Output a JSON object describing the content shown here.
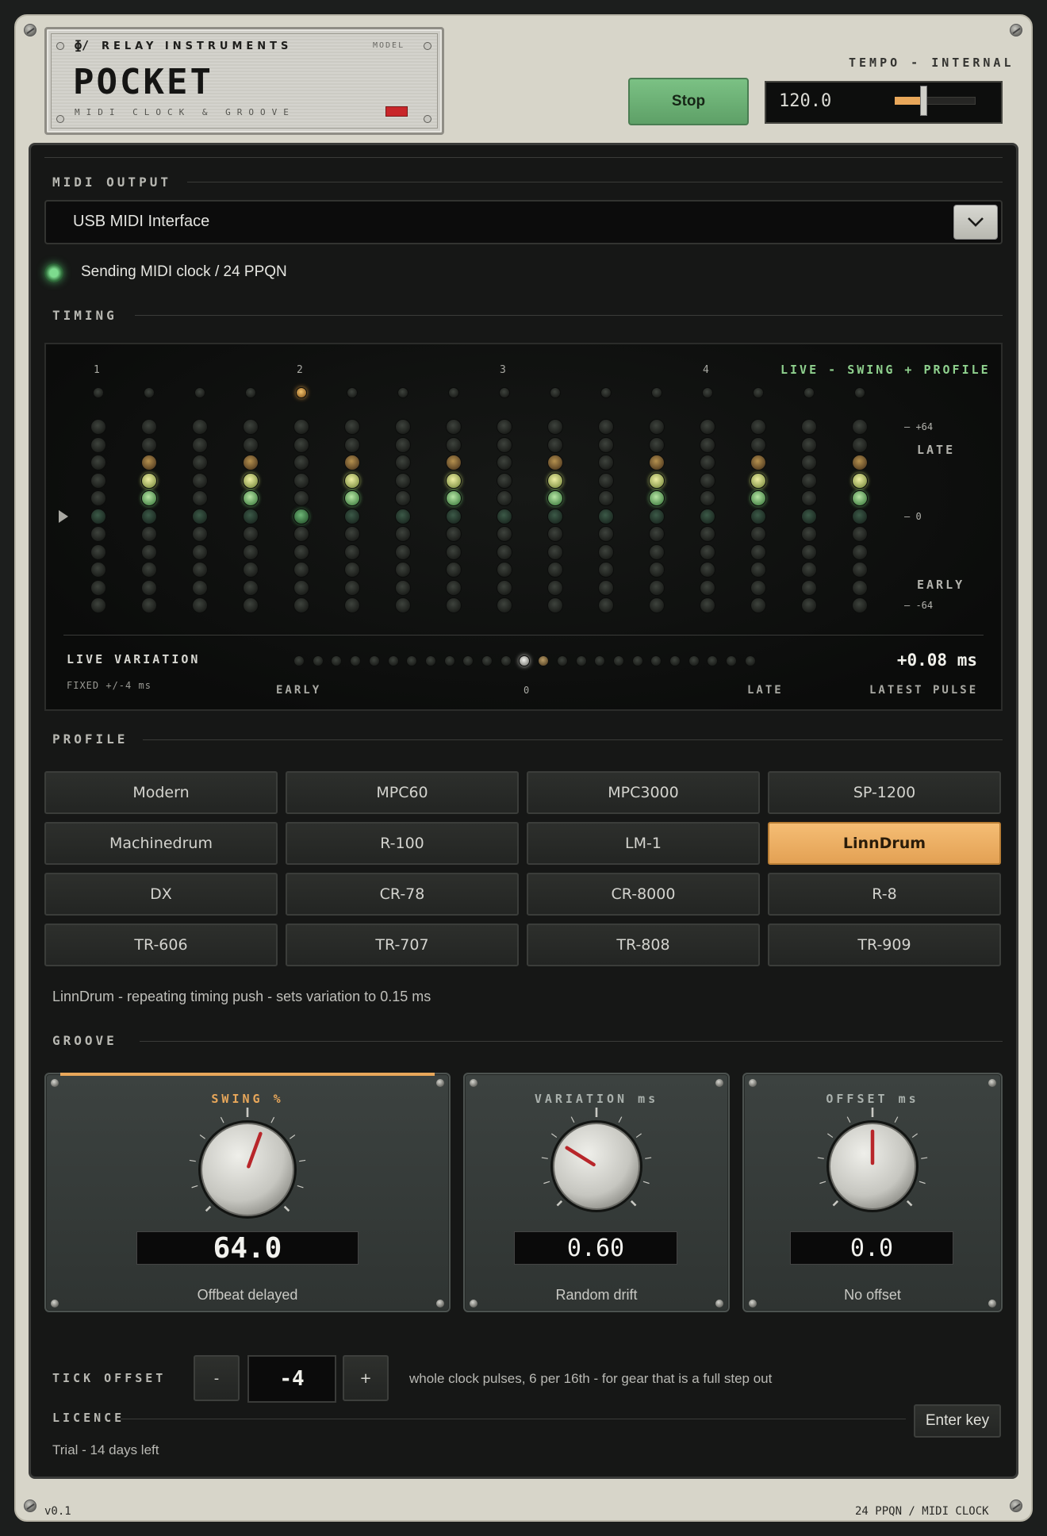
{
  "header": {
    "brand_logo": "ɸ/",
    "brand": "RELAY INSTRUMENTS",
    "model_tag": "MODEL",
    "product_name": "POCKET",
    "product_subtitle": "MIDI CLOCK & GROOVE",
    "stop_label": "Stop",
    "tempo_label": "TEMPO - INTERNAL",
    "tempo_value": "120.0",
    "tempo_slider_fraction": 0.38
  },
  "midi_output": {
    "section_label": "MIDI OUTPUT",
    "selected_device": "USB MIDI Interface",
    "status_text": "Sending MIDI clock / 24 PPQN"
  },
  "timing": {
    "section_label": "TIMING",
    "mode_tag": "LIVE - SWING + PROFILE",
    "beat_numbers": [
      "1",
      "2",
      "3",
      "4"
    ],
    "scale_top": "+64",
    "scale_mid": "0",
    "scale_bottom": "-64",
    "late_label": "LATE",
    "early_label": "EARLY",
    "live_variation_label": "LIVE VARIATION",
    "fixed_note": "FIXED +/-4 ms",
    "latest_pulse_value": "+0.08 ms",
    "meter_early": "EARLY",
    "meter_zero": "0",
    "meter_late": "LATE",
    "latest_pulse_label": "LATEST PULSE",
    "meter_active_index": 12
  },
  "profile": {
    "section_label": "PROFILE",
    "buttons": [
      "Modern",
      "MPC60",
      "MPC3000",
      "SP-1200",
      "Machinedrum",
      "R-100",
      "LM-1",
      "LinnDrum",
      "DX",
      "CR-78",
      "CR-8000",
      "R-8",
      "TR-606",
      "TR-707",
      "TR-808",
      "TR-909"
    ],
    "active": "LinnDrum",
    "description": "LinnDrum  -  repeating timing push  -  sets variation to 0.15 ms"
  },
  "groove": {
    "section_label": "GROOVE",
    "swing": {
      "title": "SWING  %",
      "value": "64.0",
      "subtitle": "Offbeat delayed",
      "color": "#e8a75a"
    },
    "variation": {
      "title": "VARIATION  ms",
      "value": "0.60",
      "subtitle": "Random drift",
      "color": "#aab1ad"
    },
    "offset": {
      "title": "OFFSET  ms",
      "value": "0.0",
      "subtitle": "No offset",
      "color": "#aab1ad"
    }
  },
  "tick_offset": {
    "label": "TICK OFFSET",
    "minus": "-",
    "value": "-4",
    "plus": "+",
    "description": "whole clock pulses, 6 per 16th  -  for gear that is a full step out"
  },
  "licence": {
    "label": "LICENCE",
    "enter_key_label": "Enter key",
    "status": "Trial - 14 days left"
  },
  "footer": {
    "version": "v0.1",
    "right": "24 PPQN / MIDI CLOCK"
  }
}
